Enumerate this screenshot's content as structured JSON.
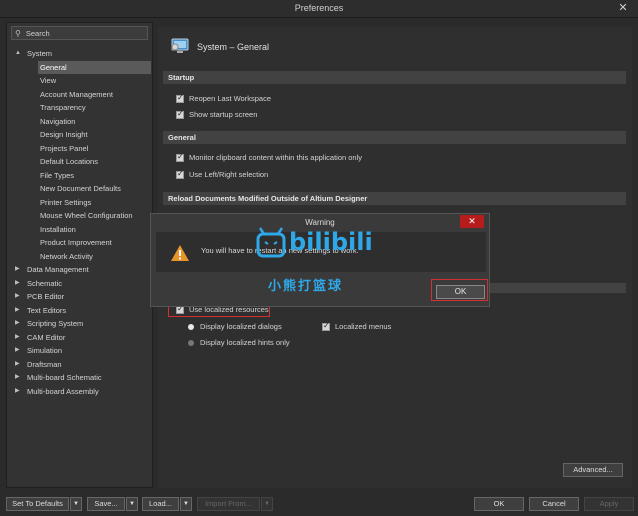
{
  "window": {
    "title": "Preferences",
    "close_glyph": "✕"
  },
  "search": {
    "placeholder": "Search",
    "icon": "search-icon"
  },
  "tree": [
    {
      "label": "System",
      "expanded": true,
      "level": 0
    },
    {
      "label": "General",
      "level": 1,
      "selected": true
    },
    {
      "label": "View",
      "level": 1
    },
    {
      "label": "Account Management",
      "level": 1
    },
    {
      "label": "Transparency",
      "level": 1
    },
    {
      "label": "Navigation",
      "level": 1
    },
    {
      "label": "Design Insight",
      "level": 1
    },
    {
      "label": "Projects Panel",
      "level": 1
    },
    {
      "label": "Default Locations",
      "level": 1
    },
    {
      "label": "File Types",
      "level": 1
    },
    {
      "label": "New Document Defaults",
      "level": 1
    },
    {
      "label": "Printer Settings",
      "level": 1
    },
    {
      "label": "Mouse Wheel Configuration",
      "level": 1
    },
    {
      "label": "Installation",
      "level": 1
    },
    {
      "label": "Product Improvement",
      "level": 1
    },
    {
      "label": "Network Activity",
      "level": 1
    },
    {
      "label": "Data Management",
      "level": 0
    },
    {
      "label": "Schematic",
      "level": 0
    },
    {
      "label": "PCB Editor",
      "level": 0
    },
    {
      "label": "Text Editors",
      "level": 0
    },
    {
      "label": "Scripting System",
      "level": 0
    },
    {
      "label": "CAM Editor",
      "level": 0
    },
    {
      "label": "Simulation",
      "level": 0
    },
    {
      "label": "Draftsman",
      "level": 0
    },
    {
      "label": "Multi-board Schematic",
      "level": 0
    },
    {
      "label": "Multi-board Assembly",
      "level": 0
    }
  ],
  "page": {
    "title": "System – General",
    "sections": {
      "startup": "Startup",
      "general": "General",
      "reload": "Reload Documents Modified Outside of Altium Designer"
    },
    "options": {
      "reopen_workspace": "Reopen Last Workspace",
      "show_startup": "Show startup screen",
      "monitor_clipboard": "Monitor clipboard content within this application only",
      "left_right": "Use Left/Right selection",
      "localized_resources": "Use localized resources",
      "localized_dialogs": "Display localized dialogs",
      "localized_menus": "Localized menus",
      "localized_hints": "Display localized hints only"
    },
    "advanced_button": "Advanced..."
  },
  "dialog": {
    "title": "Warning",
    "message": "You will have to restart an    new settings to work.",
    "ok": "OK",
    "close_glyph": "✕"
  },
  "watermark": {
    "text": "bilibili",
    "subtitle": "小熊打篮球"
  },
  "footer": {
    "set_defaults": "Set To Defaults",
    "save": "Save...",
    "load": "Load...",
    "import_from": "Import From...",
    "ok": "OK",
    "cancel": "Cancel",
    "apply": "Apply",
    "dropdown_glyph": "▼"
  },
  "colors": {
    "accent_red": "#d03030",
    "watermark_blue": "#2ea8e8",
    "warning_orange": "#e8942a"
  }
}
